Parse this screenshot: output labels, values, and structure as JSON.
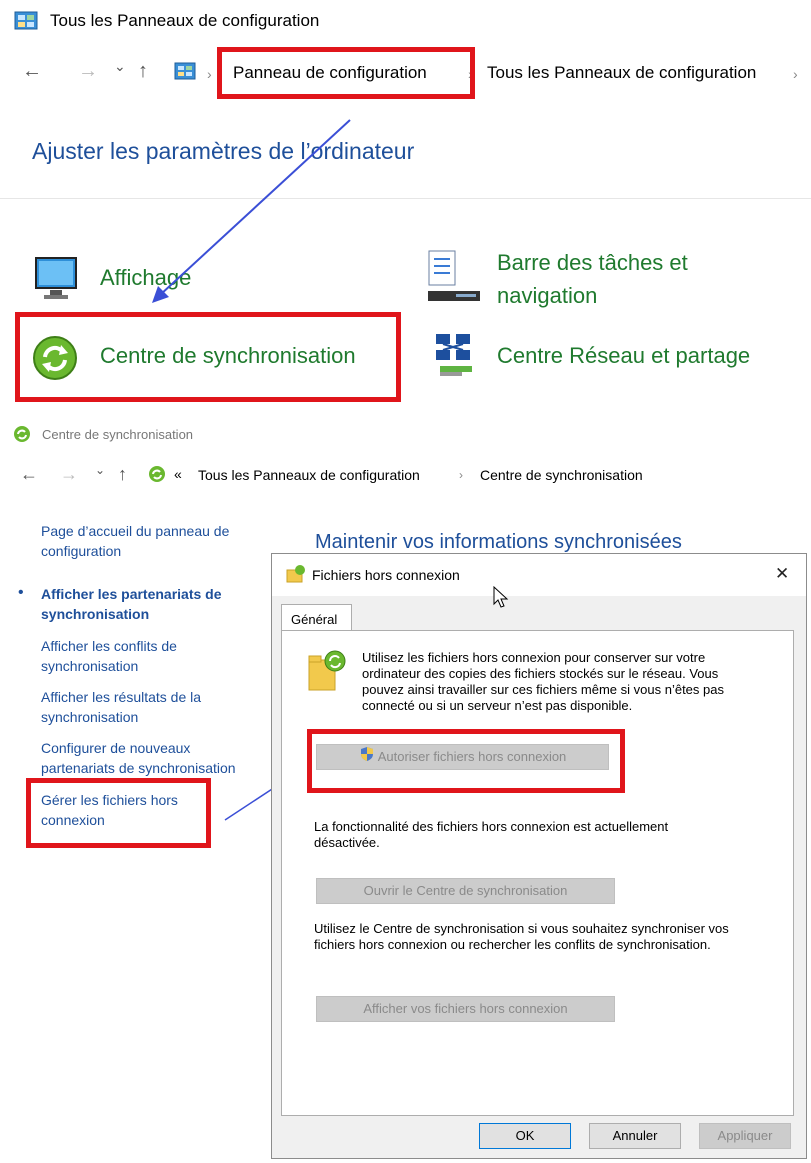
{
  "window1": {
    "title": "Tous les Panneaux de configuration",
    "breadcrumb": [
      "Panneau de configuration",
      "Tous les Panneaux de configuration"
    ],
    "heading": "Ajuster les paramètres de l’ordinateur",
    "items": {
      "affichage": "Affichage",
      "barre_line1": "Barre des tâches et",
      "barre_line2": "navigation",
      "sync": "Centre de synchronisation",
      "reseau": "Centre Réseau et partage"
    }
  },
  "window2": {
    "title": "Centre de synchronisation",
    "breadcrumb_prefix": "«",
    "breadcrumb": [
      "Tous les Panneaux de configuration",
      "Centre de synchronisation"
    ],
    "sidebar": {
      "home_line1": "Page d’accueil du panneau de",
      "home_line2": "configuration",
      "bullet": "•",
      "partners_line1": "Afficher les partenariats de",
      "partners_line2": "synchronisation",
      "conflicts_line1": "Afficher les conflits de",
      "conflicts_line2": "synchronisation",
      "results_line1": "Afficher les résultats de la",
      "results_line2": "synchronisation",
      "configure_line1": "Configurer de nouveaux",
      "configure_line2": "partenariats de synchronisation",
      "manage_line1": "Gérer les fichiers hors",
      "manage_line2": "connexion"
    },
    "main_heading": "Maintenir vos informations synchronisées"
  },
  "dialog": {
    "title": "Fichiers hors connexion",
    "close": "✕",
    "tab": "Général",
    "intro_line1": "Utilisez les fichiers hors connexion pour conserver sur votre",
    "intro_line2": "ordinateur des copies des fichiers stockés sur le réseau. Vous",
    "intro_line3": "pouvez ainsi travailler sur ces fichiers même si vous n’êtes pas",
    "intro_line4": "connecté ou si un serveur n’est pas disponible.",
    "enable_button": "Autoriser fichiers hors connexion",
    "status_line1": "La fonctionnalité des fichiers hors connexion est actuellement",
    "status_line2": "désactivée.",
    "open_sync_button": "Ouvrir le Centre de synchronisation",
    "sync_text_line1": "Utilisez le Centre de synchronisation si vous souhaitez synchroniser vos",
    "sync_text_line2": "fichiers hors connexion ou rechercher les conflits de synchronisation.",
    "view_files_button": "Afficher vos fichiers hors connexion",
    "ok": "OK",
    "cancel": "Annuler",
    "apply": "Appliquer"
  },
  "nav_glyphs": {
    "back": "←",
    "forward": "→",
    "down": "⌄",
    "up": "↑",
    "sep": "›"
  },
  "colors": {
    "highlight": "#e0151b",
    "arrow": "#3b4fd6",
    "link": "#1e4f9a",
    "cp_link": "#1f7a2e"
  }
}
